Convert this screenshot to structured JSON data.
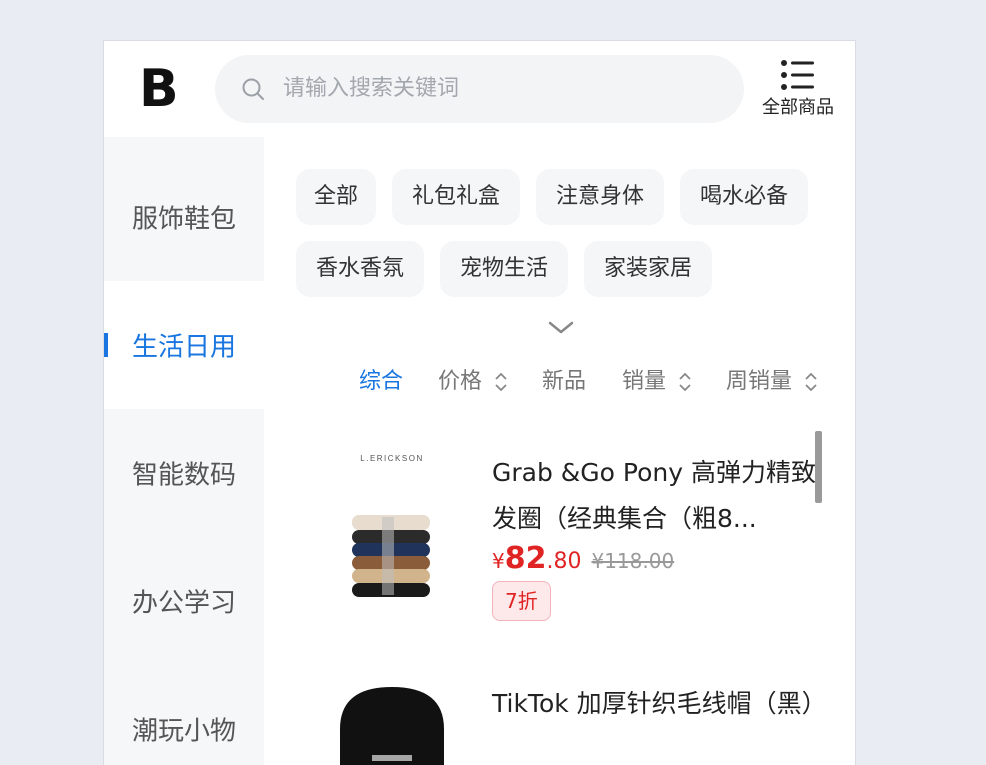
{
  "header": {
    "logo_text": "B",
    "search_placeholder": "请输入搜索关键词",
    "all_goods_label": "全部商品"
  },
  "sidebar": {
    "items": [
      {
        "label": "服饰鞋包",
        "active": false
      },
      {
        "label": "生活日用",
        "active": true
      },
      {
        "label": "智能数码",
        "active": false
      },
      {
        "label": "办公学习",
        "active": false
      },
      {
        "label": "潮玩小物",
        "active": false
      }
    ]
  },
  "chips": [
    "全部",
    "礼包礼盒",
    "注意身体",
    "喝水必备",
    "香水香氛",
    "宠物生活",
    "家装家居"
  ],
  "sort": {
    "items": [
      "综合",
      "价格",
      "新品",
      "销量",
      "周销量"
    ],
    "active": "综合"
  },
  "products": [
    {
      "title": "Grab &Go Pony 高弹力精致发圈（经典集合（粗8...",
      "brand_print": "L.ERICKSON",
      "currency": "¥",
      "price_int": "82",
      "price_dec": ".80",
      "original_price": "¥118.00",
      "discount": "7折"
    },
    {
      "title": "TikTok 加厚针织毛线帽（黑）"
    }
  ],
  "colors": {
    "accent": "#1976e1",
    "price": "#e02424",
    "badge_bg": "#fde8ea"
  }
}
